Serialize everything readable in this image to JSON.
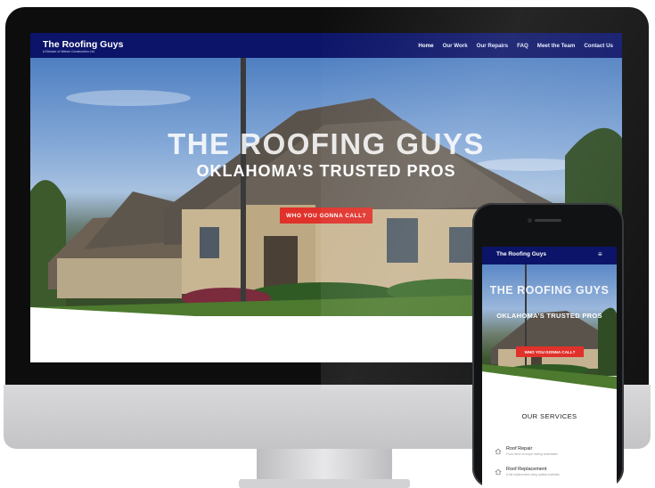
{
  "site": {
    "brand": "The Roofing Guys",
    "tagline": "A Division of Weiser Construction Ltd.",
    "nav": [
      "Home",
      "Our Work",
      "Our Repairs",
      "FAQ",
      "Meet the Team",
      "Contact Us"
    ],
    "hero_title": "THE ROOFING GUYS",
    "hero_subtitle": "OKLAHOMA’S TRUSTED PROS",
    "cta": "WHO YOU GONNA CALL?"
  },
  "mobile": {
    "brand": "The Roofing Guys",
    "menu_icon": "hamburger-icon",
    "hero_title": "THE ROOFING GUYS",
    "hero_subtitle": "OKLAHOMA’S TRUSTED PROS",
    "cta": "WHO YOU GONNA CALL?",
    "services_heading": "OUR SERVICES",
    "services": [
      {
        "title": "Roof Repair",
        "desc": "From minor to major roofing undertaken",
        "icon": "house-icon"
      },
      {
        "title": "Roof Replacement",
        "desc": "A full replacement using quality materials",
        "icon": "house-icon"
      }
    ]
  },
  "colors": {
    "nav_bg": "#0b1468",
    "cta_red": "#e0312a"
  }
}
